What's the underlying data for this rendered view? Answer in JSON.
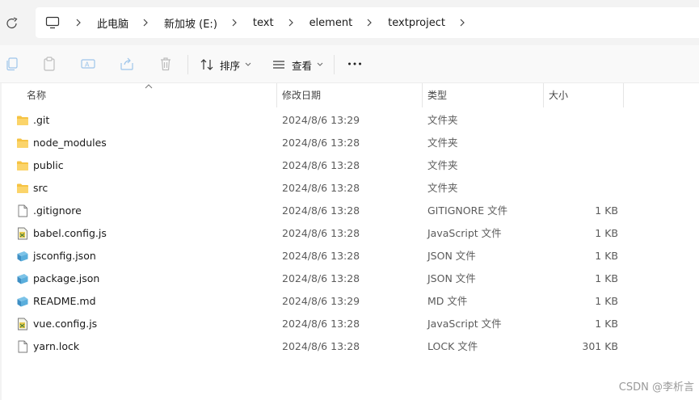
{
  "breadcrumb": {
    "root_icon": "computer-icon",
    "items": [
      "此电脑",
      "新加坡 (E:)",
      "text",
      "element",
      "textproject"
    ]
  },
  "toolbar": {
    "icons": [
      "copy-icon",
      "paste-icon",
      "rename-icon",
      "share-icon",
      "delete-icon"
    ],
    "sort_label": "排序",
    "view_label": "查看",
    "more_icon": "more-icon"
  },
  "columns": {
    "name": "名称",
    "modified": "修改日期",
    "type": "类型",
    "size": "大小"
  },
  "files": [
    {
      "name": ".git",
      "date": "2024/8/6 13:29",
      "type": "文件夹",
      "size": "",
      "icon": "folder-icon"
    },
    {
      "name": "node_modules",
      "date": "2024/8/6 13:28",
      "type": "文件夹",
      "size": "",
      "icon": "folder-icon"
    },
    {
      "name": "public",
      "date": "2024/8/6 13:28",
      "type": "文件夹",
      "size": "",
      "icon": "folder-icon"
    },
    {
      "name": "src",
      "date": "2024/8/6 13:28",
      "type": "文件夹",
      "size": "",
      "icon": "folder-icon"
    },
    {
      "name": ".gitignore",
      "date": "2024/8/6 13:28",
      "type": "GITIGNORE 文件",
      "size": "1 KB",
      "icon": "blank-file-icon"
    },
    {
      "name": "babel.config.js",
      "date": "2024/8/6 13:28",
      "type": "JavaScript 文件",
      "size": "1 KB",
      "icon": "js-file-icon"
    },
    {
      "name": "jsconfig.json",
      "date": "2024/8/6 13:28",
      "type": "JSON 文件",
      "size": "1 KB",
      "icon": "json-file-icon"
    },
    {
      "name": "package.json",
      "date": "2024/8/6 13:28",
      "type": "JSON 文件",
      "size": "1 KB",
      "icon": "json-file-icon"
    },
    {
      "name": "README.md",
      "date": "2024/8/6 13:29",
      "type": "MD 文件",
      "size": "1 KB",
      "icon": "md-file-icon"
    },
    {
      "name": "vue.config.js",
      "date": "2024/8/6 13:28",
      "type": "JavaScript 文件",
      "size": "1 KB",
      "icon": "js-file-icon"
    },
    {
      "name": "yarn.lock",
      "date": "2024/8/6 13:28",
      "type": "LOCK 文件",
      "size": "301 KB",
      "icon": "blank-file-icon"
    }
  ],
  "watermark": "CSDN @李析言",
  "colors": {
    "folder": "#f6c343",
    "accent": "#0067c0",
    "toolbar_bg": "#f9f9f9",
    "addrbar_bg": "#f3f3f3"
  }
}
